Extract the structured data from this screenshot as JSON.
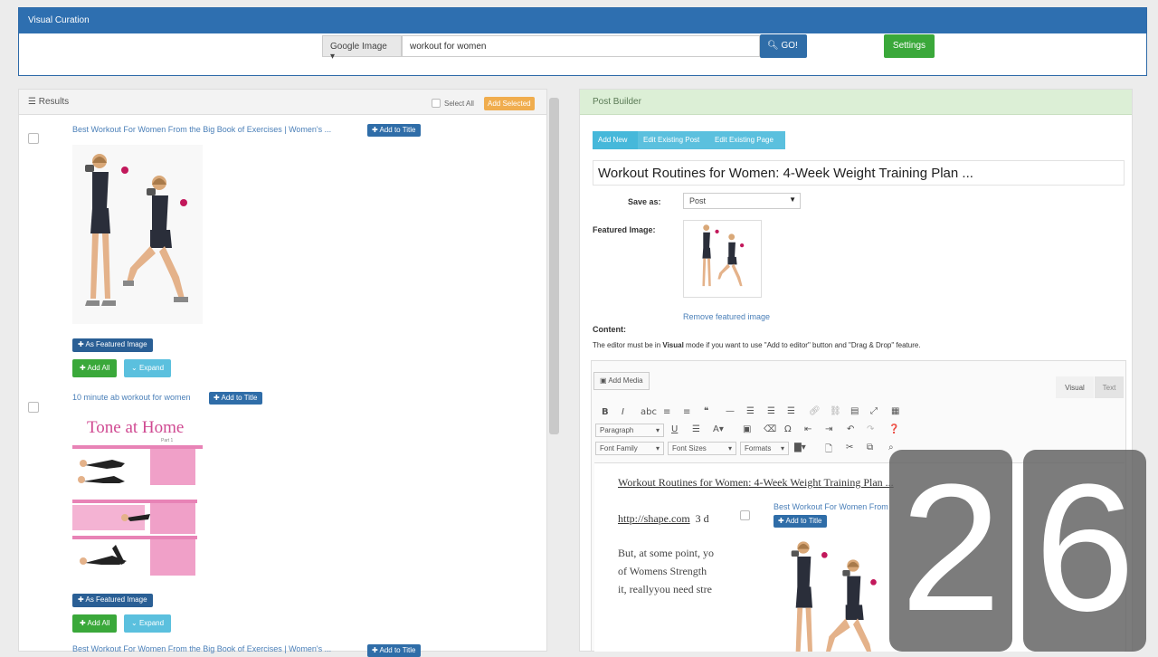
{
  "header": {
    "title": "Visual Curation",
    "source": "Google Image",
    "search_value": "workout for women",
    "go_label": "GO!",
    "settings_label": "Settings"
  },
  "results": {
    "title": "Results",
    "select_all": "Select All",
    "add_selected": "Add Selected",
    "items": [
      {
        "title": "Best Workout For Women From the Big Book of Exercises | Women's ...",
        "add_to_title": "Add to Title",
        "featured_label": "As Featured Image",
        "add_all": "Add All",
        "expand": "Expand"
      },
      {
        "title": "10 minute ab workout for women",
        "add_to_title": "Add to Title",
        "image_caption": "Tone at Home",
        "image_subcaption": "Part 1",
        "featured_label": "As Featured Image",
        "add_all": "Add All",
        "expand": "Expand"
      },
      {
        "title": "Best Workout For Women From the Big Book of Exercises | Women's ...",
        "add_to_title": "Add to Title"
      }
    ]
  },
  "post_builder": {
    "title": "Post Builder",
    "tabs": [
      "Add New",
      "Edit Existing Post",
      "Edit Existing Page"
    ],
    "post_title": "Workout Routines for Women: 4-Week Weight Training Plan ...",
    "save_as_label": "Save as:",
    "save_as_value": "Post",
    "featured_label": "Featured Image:",
    "remove_featured": "Remove featured image",
    "content_label": "Content:",
    "content_note_pre": "The editor must be in ",
    "content_note_bold": "Visual",
    "content_note_post": " mode if you want to use \"Add to editor\" button and \"Drag & Drop\" feature.",
    "add_media": "Add Media",
    "mode_visual": "Visual",
    "mode_text": "Text",
    "format_dropdowns": [
      "Paragraph",
      "Font Family",
      "Font Sizes",
      "Formats"
    ],
    "editor": {
      "heading": "Workout Routines for Women: 4-Week Weight Training Plan ...",
      "link": "http://shape.com",
      "link_suffix": "3 d",
      "para_lines": [
        "But, at some point, yo",
        "of Womens Strength",
        "it, reallyyou need stre"
      ]
    }
  },
  "drag_preview": {
    "title": "Best Workout For Women From the Big Book of Exercises | Women's ...",
    "add_to_title": "Add to Title"
  },
  "counter": [
    "2",
    "6"
  ],
  "colors": {
    "header_blue": "#2e6fb0",
    "go_blue": "#2f6da8",
    "green": "#3aa83a",
    "cyan": "#5bc0de",
    "orange": "#f0ad4e",
    "post_builder_green": "#dcefd6",
    "pink": "#e06fa8"
  }
}
